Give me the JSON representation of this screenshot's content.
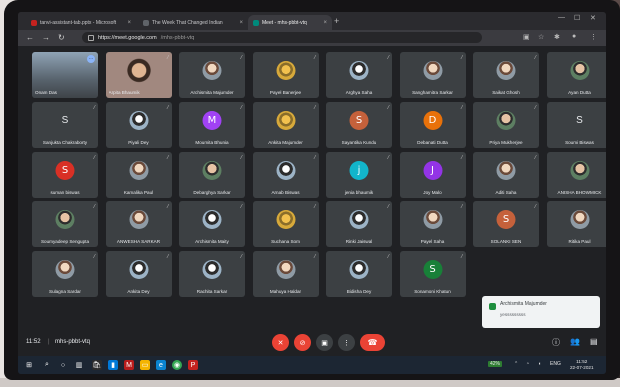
{
  "browser": {
    "tabs": [
      {
        "label": "tanvi-assistant-tab.pptx - Microsoft",
        "color": "#c5221f"
      },
      {
        "label": "The Week That Changed Indian",
        "color": "#5f6368"
      },
      {
        "label": "Meet - mhs-pbbt-vtq",
        "color": "#00897b"
      }
    ],
    "new_tab": "+",
    "address": {
      "host": "https://meet.google.com",
      "path": "/mhs-pbbt-vtq"
    }
  },
  "meet": {
    "participants": [
      {
        "name": "Onam Das",
        "style": "video",
        "color": "#6b7a8c"
      },
      {
        "name": "Arpita Bhaumik",
        "style": "video2",
        "color": "#8d6e63"
      },
      {
        "name": "Archismita Majumder",
        "style": "photo",
        "color": "#3c4043"
      },
      {
        "name": "Payel Banerjee",
        "style": "photo4",
        "color": "#3c4043"
      },
      {
        "name": "Arghya Saha",
        "style": "photo3",
        "color": "#3c4043"
      },
      {
        "name": "Sanghamitra Sarkar",
        "style": "photo",
        "color": "#3c4043"
      },
      {
        "name": "Saikat Ghosh",
        "style": "photo",
        "color": "#3c4043"
      },
      {
        "name": "Ayan Dutta",
        "style": "photo2",
        "color": "#3c4043"
      },
      {
        "name": "Sanjukta Chakraborty",
        "style": "plain",
        "letter": "S"
      },
      {
        "name": "Piyali Dey",
        "style": "photo3",
        "color": "#3c4043"
      },
      {
        "name": "Moumita Bhunia",
        "style": "letter",
        "letter": "M",
        "color": "#a142f4"
      },
      {
        "name": "Ankita Majumder",
        "style": "photo4",
        "color": "#3c4043"
      },
      {
        "name": "Sayantika Kundu",
        "style": "letter",
        "letter": "S",
        "color": "#c5613b"
      },
      {
        "name": "Debanati Dutta",
        "style": "letter",
        "letter": "D",
        "color": "#e8710a"
      },
      {
        "name": "Priya Mukherjee",
        "style": "photo2",
        "color": "#3c4043"
      },
      {
        "name": "Soumi Biswas",
        "style": "plain",
        "letter": "S"
      },
      {
        "name": "suman biswas",
        "style": "letter",
        "letter": "S",
        "color": "#d93025"
      },
      {
        "name": "Kamalika Paul",
        "style": "photo",
        "color": "#3c4043"
      },
      {
        "name": "Debarghya Sarkar",
        "style": "photo2",
        "color": "#3c4043"
      },
      {
        "name": "Arnab Biswas",
        "style": "photo3",
        "color": "#3c4043"
      },
      {
        "name": "jenia bhaumik",
        "style": "letter",
        "letter": "j",
        "color": "#12b5cb"
      },
      {
        "name": "Joy Malo",
        "style": "letter",
        "letter": "J",
        "color": "#9334e6"
      },
      {
        "name": "Aditi Saha",
        "style": "photo",
        "color": "#3c4043"
      },
      {
        "name": "ANISHA BHOWMICK",
        "style": "photo2",
        "color": "#3c4043"
      },
      {
        "name": "Soumyadeep Sengupta",
        "style": "photo2",
        "color": "#3c4043"
      },
      {
        "name": "ANWESHA SARKAR",
        "style": "photo",
        "color": "#3c4043"
      },
      {
        "name": "Archismita Maity",
        "style": "photo3",
        "color": "#3c4043"
      },
      {
        "name": "Suchana Som",
        "style": "photo4",
        "color": "#3c4043"
      },
      {
        "name": "Rinki Jaiswal",
        "style": "photo3",
        "color": "#3c4043"
      },
      {
        "name": "Payel Saha",
        "style": "photo",
        "color": "#3c4043"
      },
      {
        "name": "SOLANKI SEN",
        "style": "letter",
        "letter": "S",
        "color": "#c5613b"
      },
      {
        "name": "Ritika Paul",
        "style": "photo",
        "color": "#3c4043"
      },
      {
        "name": "Sulagna Sardar",
        "style": "photo",
        "color": "#3c4043"
      },
      {
        "name": "Ankita Dey",
        "style": "photo3",
        "color": "#3c4043"
      },
      {
        "name": "Rachita Sarkar",
        "style": "photo3",
        "color": "#3c4043"
      },
      {
        "name": "Mahuya Haldar",
        "style": "photo",
        "color": "#3c4043"
      },
      {
        "name": "Bidisha Dey",
        "style": "photo3",
        "color": "#3c4043"
      },
      {
        "name": "Sonamoni Khatun",
        "style": "letter",
        "letter": "S",
        "color": "#188038"
      }
    ],
    "notification": {
      "title": "Archismita Majumder",
      "message": "yesssssssss"
    },
    "time": "11:52",
    "meeting_code": "mhs-pbbt-vtq",
    "separator": "|"
  },
  "taskbar": {
    "battery": "42%",
    "lang": "ENG",
    "time": "11:52",
    "date": "22-07-2021"
  }
}
